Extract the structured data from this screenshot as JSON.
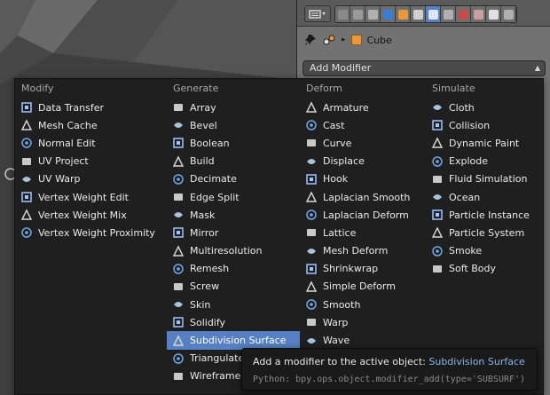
{
  "header": {
    "editor_icon": "properties-editor-icon",
    "tabs": [
      {
        "icon": "render-icon",
        "color": "#8a8a8a"
      },
      {
        "icon": "render-layers-icon",
        "color": "#9a9a9a"
      },
      {
        "icon": "scene-icon",
        "color": "#b0b0b0"
      },
      {
        "icon": "world-icon",
        "color": "#3a7dd8"
      },
      {
        "icon": "object-icon",
        "color": "#e89a3a"
      },
      {
        "icon": "constraints-icon",
        "color": "#d0d0d0"
      },
      {
        "icon": "modifier-wrench-icon",
        "color": "#dde6f5"
      },
      {
        "icon": "data-mesh-icon",
        "color": "#b0b0b0"
      },
      {
        "icon": "material-icon",
        "color": "#c84a4a"
      },
      {
        "icon": "texture-icon",
        "color": "#c8a0a0"
      },
      {
        "icon": "particles-icon",
        "color": "#e0e0e0"
      },
      {
        "icon": "physics-icon",
        "color": "#b0b0b0"
      }
    ]
  },
  "context": {
    "object_name": "Cube"
  },
  "add_modifier": {
    "label": "Add Modifier"
  },
  "menu": {
    "columns": [
      {
        "title": "Modify",
        "items": [
          {
            "label": "Data Transfer",
            "icon": "data-transfer-icon"
          },
          {
            "label": "Mesh Cache",
            "icon": "mesh-cache-icon"
          },
          {
            "label": "Normal Edit",
            "icon": "normal-edit-icon"
          },
          {
            "label": "UV Project",
            "icon": "uv-project-icon"
          },
          {
            "label": "UV Warp",
            "icon": "uv-warp-icon"
          },
          {
            "label": "Vertex Weight Edit",
            "icon": "vertex-weight-edit-icon"
          },
          {
            "label": "Vertex Weight Mix",
            "icon": "vertex-weight-mix-icon"
          },
          {
            "label": "Vertex Weight Proximity",
            "icon": "vertex-weight-proximity-icon"
          }
        ]
      },
      {
        "title": "Generate",
        "items": [
          {
            "label": "Array",
            "icon": "array-icon"
          },
          {
            "label": "Bevel",
            "icon": "bevel-icon"
          },
          {
            "label": "Boolean",
            "icon": "boolean-icon"
          },
          {
            "label": "Build",
            "icon": "build-icon"
          },
          {
            "label": "Decimate",
            "icon": "decimate-icon"
          },
          {
            "label": "Edge Split",
            "icon": "edge-split-icon"
          },
          {
            "label": "Mask",
            "icon": "mask-icon"
          },
          {
            "label": "Mirror",
            "icon": "mirror-icon"
          },
          {
            "label": "Multiresolution",
            "icon": "multiresolution-icon"
          },
          {
            "label": "Remesh",
            "icon": "remesh-icon"
          },
          {
            "label": "Screw",
            "icon": "screw-icon"
          },
          {
            "label": "Skin",
            "icon": "skin-icon"
          },
          {
            "label": "Solidify",
            "icon": "solidify-icon"
          },
          {
            "label": "Subdivision Surface",
            "icon": "subdivision-surface-icon",
            "highlighted": true
          },
          {
            "label": "Triangulate",
            "icon": "triangulate-icon"
          },
          {
            "label": "Wireframe",
            "icon": "wireframe-icon"
          }
        ]
      },
      {
        "title": "Deform",
        "items": [
          {
            "label": "Armature",
            "icon": "armature-icon"
          },
          {
            "label": "Cast",
            "icon": "cast-icon"
          },
          {
            "label": "Curve",
            "icon": "curve-icon"
          },
          {
            "label": "Displace",
            "icon": "displace-icon"
          },
          {
            "label": "Hook",
            "icon": "hook-icon"
          },
          {
            "label": "Laplacian Smooth",
            "icon": "laplacian-smooth-icon"
          },
          {
            "label": "Laplacian Deform",
            "icon": "laplacian-deform-icon"
          },
          {
            "label": "Lattice",
            "icon": "lattice-icon"
          },
          {
            "label": "Mesh Deform",
            "icon": "mesh-deform-icon"
          },
          {
            "label": "Shrinkwrap",
            "icon": "shrinkwrap-icon"
          },
          {
            "label": "Simple Deform",
            "icon": "simple-deform-icon"
          },
          {
            "label": "Smooth",
            "icon": "smooth-icon"
          },
          {
            "label": "Warp",
            "icon": "warp-icon"
          },
          {
            "label": "Wave",
            "icon": "wave-icon"
          }
        ]
      },
      {
        "title": "Simulate",
        "items": [
          {
            "label": "Cloth",
            "icon": "cloth-icon"
          },
          {
            "label": "Collision",
            "icon": "collision-icon"
          },
          {
            "label": "Dynamic Paint",
            "icon": "dynamic-paint-icon"
          },
          {
            "label": "Explode",
            "icon": "explode-icon"
          },
          {
            "label": "Fluid Simulation",
            "icon": "fluid-simulation-icon"
          },
          {
            "label": "Ocean",
            "icon": "ocean-icon"
          },
          {
            "label": "Particle Instance",
            "icon": "particle-instance-icon"
          },
          {
            "label": "Particle System",
            "icon": "particle-system-icon"
          },
          {
            "label": "Smoke",
            "icon": "smoke-icon"
          },
          {
            "label": "Soft Body",
            "icon": "soft-body-icon"
          }
        ]
      }
    ]
  },
  "tooltip": {
    "description": "Add a modifier to the active object:",
    "value": "Subdivision Surface",
    "python": "Python: bpy.ops.object.modifier_add(type='SUBSURF')"
  }
}
